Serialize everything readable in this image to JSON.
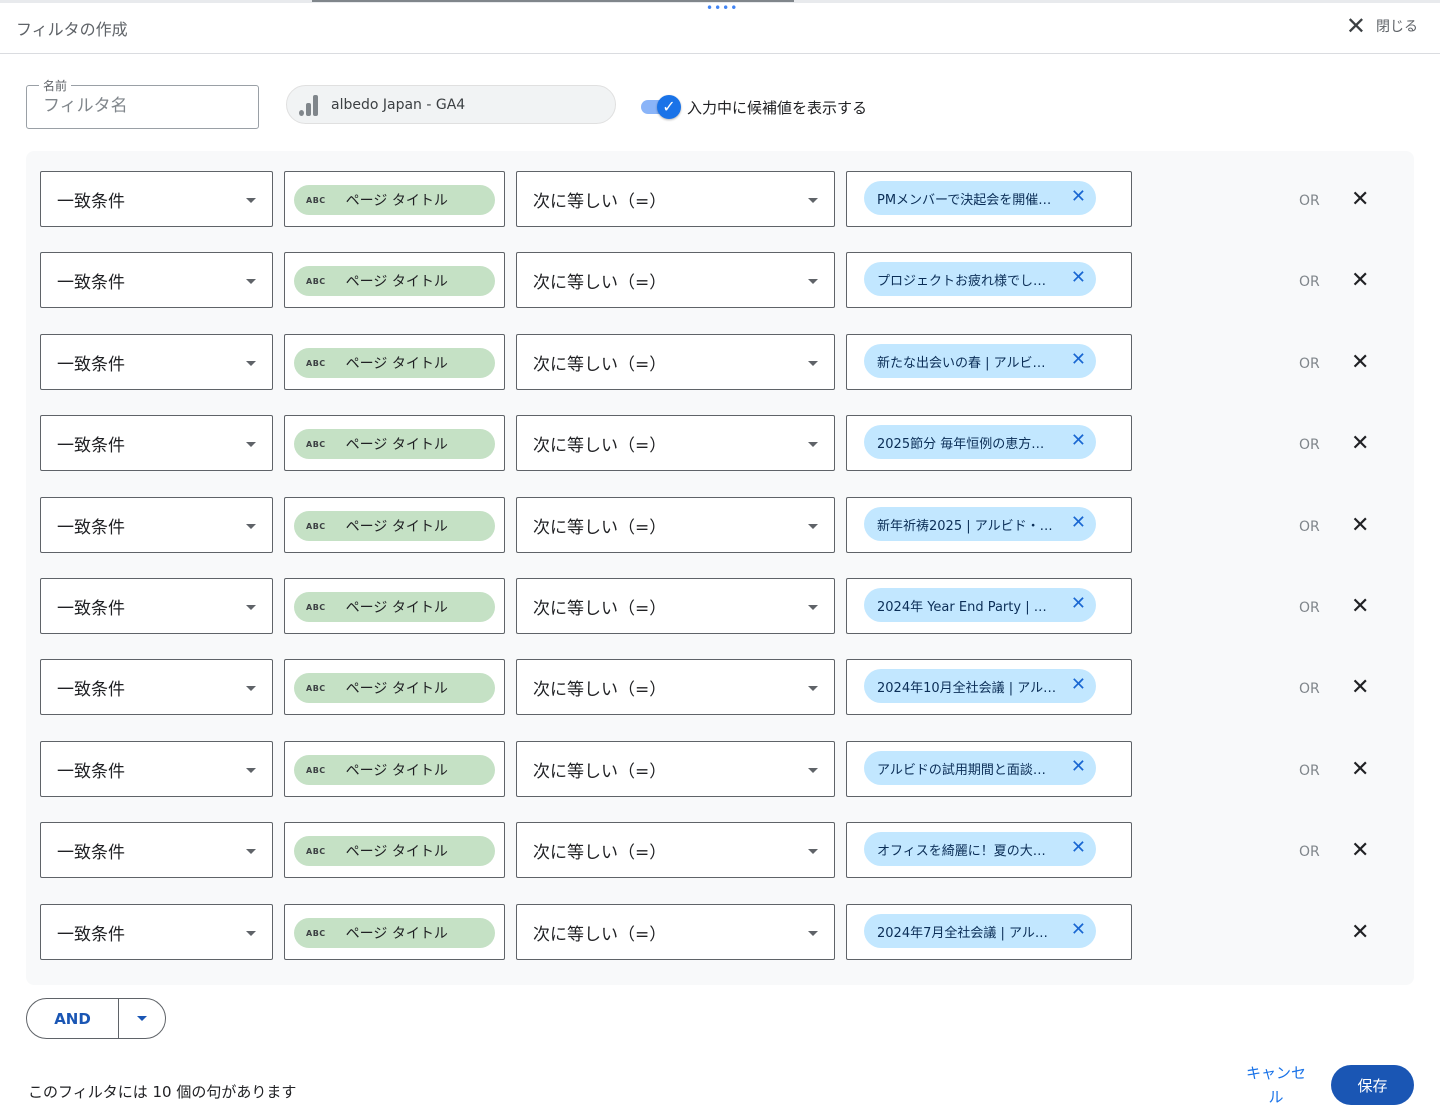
{
  "header": {
    "title": "フィルタの作成",
    "close_label": "閉じる"
  },
  "name_field": {
    "legend": "名前",
    "placeholder": "フィルタ名",
    "value": ""
  },
  "datasource": {
    "label": "albedo Japan - GA4",
    "icon": "analytics-bar-icon"
  },
  "suggest_toggle": {
    "label": "入力中に候補値を表示する",
    "checked": true
  },
  "clauses": [
    {
      "match": "一致条件",
      "dimension": "ページ タイトル",
      "dim_type": "ABC",
      "operator": "次に等しい（=）",
      "value": "PMメンバーで決起会を開催…",
      "or_label": "OR"
    },
    {
      "match": "一致条件",
      "dimension": "ページ タイトル",
      "dim_type": "ABC",
      "operator": "次に等しい（=）",
      "value": "プロジェクトお疲れ様でし…",
      "or_label": "OR"
    },
    {
      "match": "一致条件",
      "dimension": "ページ タイトル",
      "dim_type": "ABC",
      "operator": "次に等しい（=）",
      "value": "新たな出会いの春 | アルビド…",
      "or_label": "OR"
    },
    {
      "match": "一致条件",
      "dimension": "ページ タイトル",
      "dim_type": "ABC",
      "operator": "次に等しい（=）",
      "value": "2025節分 毎年恒例の恵方巻…",
      "or_label": "OR"
    },
    {
      "match": "一致条件",
      "dimension": "ページ タイトル",
      "dim_type": "ABC",
      "operator": "次に等しい（=）",
      "value": "新年祈祷2025 | アルビド・…",
      "or_label": "OR"
    },
    {
      "match": "一致条件",
      "dimension": "ページ タイトル",
      "dim_type": "ABC",
      "operator": "次に等しい（=）",
      "value": "2024年 Year End Party | ア…",
      "or_label": "OR"
    },
    {
      "match": "一致条件",
      "dimension": "ページ タイトル",
      "dim_type": "ABC",
      "operator": "次に等しい（=）",
      "value": "2024年10月全社会議 | アル…",
      "or_label": "OR"
    },
    {
      "match": "一致条件",
      "dimension": "ページ タイトル",
      "dim_type": "ABC",
      "operator": "次に等しい（=）",
      "value": "アルビドの試用期間と面談…",
      "or_label": "OR"
    },
    {
      "match": "一致条件",
      "dimension": "ページ タイトル",
      "dim_type": "ABC",
      "operator": "次に等しい（=）",
      "value": "オフィスを綺麗に！夏の大…",
      "or_label": "OR"
    },
    {
      "match": "一致条件",
      "dimension": "ページ タイトル",
      "dim_type": "ABC",
      "operator": "次に等しい（=）",
      "value": "2024年7月全社会議 | アルビ…",
      "or_label": ""
    }
  ],
  "and_button": {
    "label": "AND"
  },
  "footer": {
    "note": "このフィルタには 10 個の句があります",
    "cancel_label": "キャンセル",
    "save_label": "保存"
  },
  "colors": {
    "accent": "#1a73e8",
    "primary_button": "#1a56b4",
    "dimension_chip": "#c5e1c5",
    "value_chip": "#c2e7ff"
  }
}
